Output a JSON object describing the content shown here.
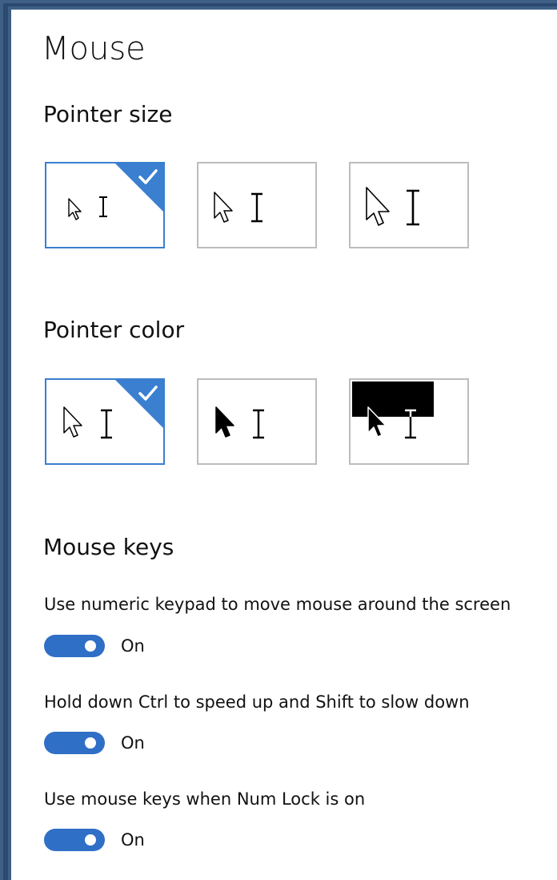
{
  "page": {
    "title": "Mouse"
  },
  "pointer_size": {
    "title": "Pointer size",
    "options": [
      {
        "name": "small",
        "selected": true
      },
      {
        "name": "medium",
        "selected": false
      },
      {
        "name": "large",
        "selected": false
      }
    ]
  },
  "pointer_color": {
    "title": "Pointer color",
    "options": [
      {
        "name": "white",
        "selected": true
      },
      {
        "name": "black",
        "selected": false
      },
      {
        "name": "inverted",
        "selected": false
      }
    ]
  },
  "mouse_keys": {
    "title": "Mouse keys",
    "settings": [
      {
        "label": "Use numeric keypad to move mouse around the screen",
        "state": "On"
      },
      {
        "label": "Hold down Ctrl to speed up and Shift to slow down",
        "state": "On"
      },
      {
        "label": "Use mouse keys when Num Lock is on",
        "state": "On"
      }
    ]
  },
  "colors": {
    "accent": "#3a7fd0",
    "toggle_on": "#2f6fc6",
    "frame": "#3e5f86",
    "border": "#bdbdbd"
  },
  "icons": [
    "arrow-pointer-icon",
    "text-cursor-icon",
    "checkmark-icon"
  ]
}
